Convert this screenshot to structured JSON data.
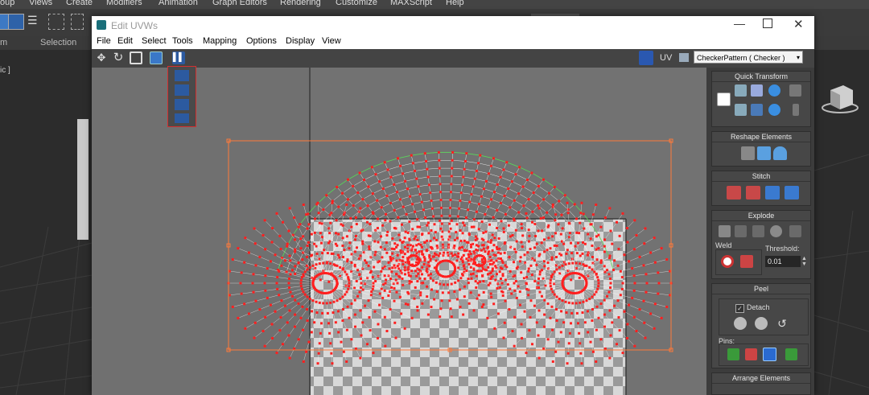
{
  "host": {
    "menu": [
      "oup",
      "Views",
      "Create",
      "Modifiers",
      "Animation",
      "Graph Editors",
      "Rendering",
      "Customize",
      "MAXScript",
      "Help"
    ],
    "ribbon": {
      "left": "m",
      "selection": "Selection"
    },
    "viewport_label": "ic ]"
  },
  "uvw": {
    "title": "Edit UVWs",
    "menu": [
      "File",
      "Edit",
      "Select",
      "Tools",
      "Mapping",
      "Options",
      "Display",
      "View"
    ],
    "toolbar": {
      "uv_label": "UV",
      "texture_select": "CheckerPattern  ( Checker )"
    },
    "rollout": {
      "quick_transform": "Quick Transform",
      "reshape_elements": "Reshape Elements",
      "stitch": "Stitch",
      "explode": "Explode",
      "weld": "Weld",
      "threshold_label": "Threshold:",
      "threshold_value": "0.01",
      "peel": "Peel",
      "detach": "Detach",
      "pins": "Pins:",
      "arrange_elements": "Arrange Elements"
    }
  },
  "colors": {
    "uv_vertex": "#ff1f1f",
    "uv_edge": "#ffffff",
    "seam": "#47d147",
    "selection_box": "#ff7a3a",
    "highlight_frame": "#d23030"
  }
}
